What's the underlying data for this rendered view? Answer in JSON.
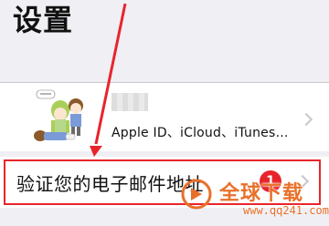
{
  "header": {
    "title": "设置"
  },
  "account": {
    "subtitle": "Apple ID、iCloud、iTunes…",
    "avatar_icon": "cartoon-avatar-icon"
  },
  "verify_email": {
    "label": "验证您的电子邮件地址",
    "badge_count": "1"
  },
  "watermark": {
    "text": "全球下载",
    "url": "www.qq241.com",
    "color": "#e9702a"
  },
  "colors": {
    "annotation_red": "#e8242b",
    "background": "#efeff4",
    "row_background": "#ffffff"
  }
}
